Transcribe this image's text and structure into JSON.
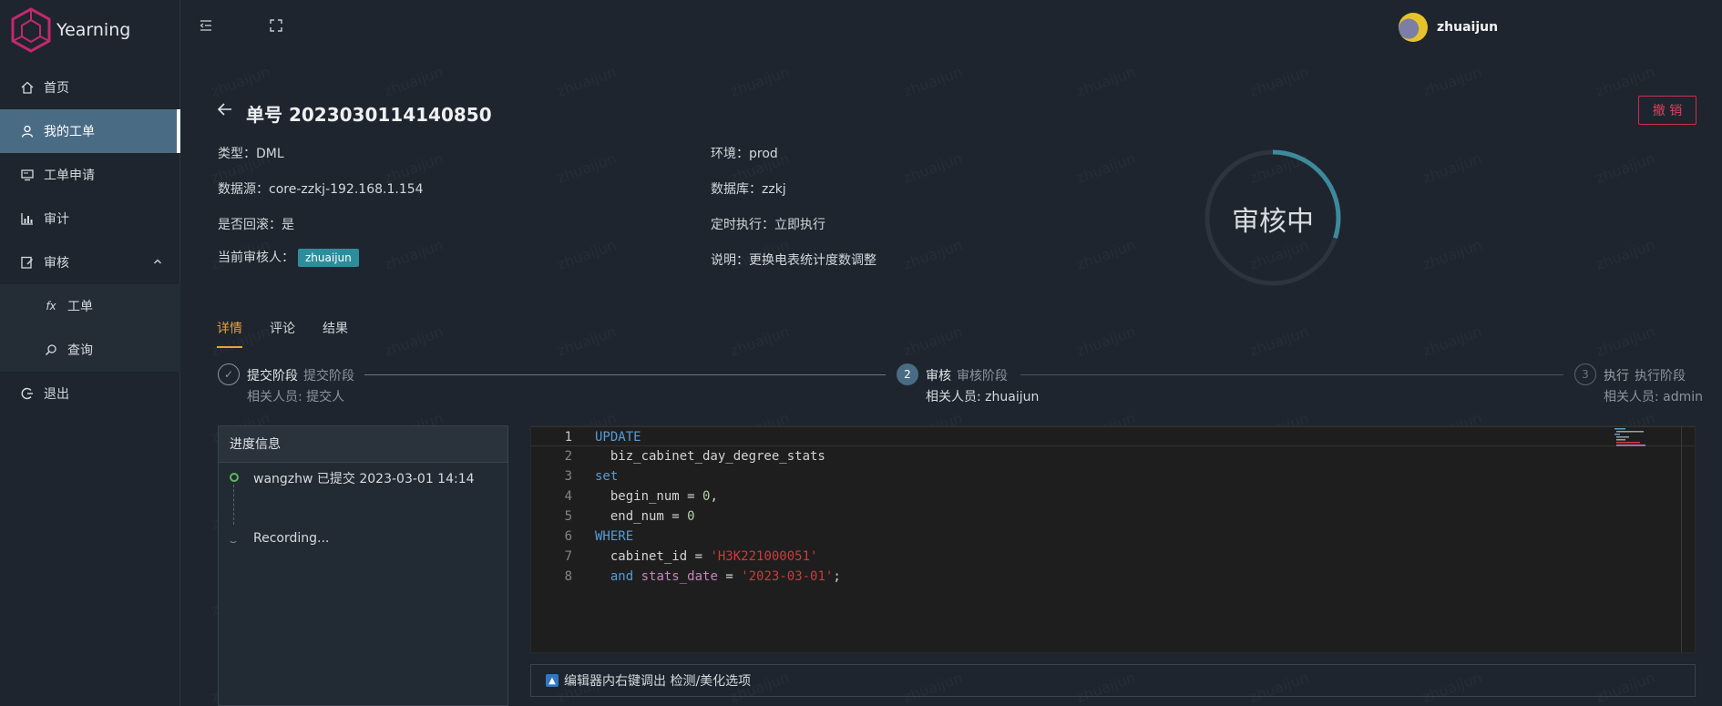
{
  "app": {
    "name": "Yearning",
    "watermark": "zhuaijun"
  },
  "sidebar": {
    "items": [
      {
        "label": "首页",
        "icon": "home-icon"
      },
      {
        "label": "我的工单",
        "icon": "user-icon"
      },
      {
        "label": "工单申请",
        "icon": "monitor-icon"
      },
      {
        "label": "审计",
        "icon": "chart-icon"
      },
      {
        "label": "审核",
        "icon": "edit-icon"
      },
      {
        "label": "工单",
        "icon": "fx-icon"
      },
      {
        "label": "查询",
        "icon": "search-icon"
      },
      {
        "label": "退出",
        "icon": "logout-icon"
      }
    ]
  },
  "header": {
    "username": "zhuaijun"
  },
  "order": {
    "title": "单号 2023030114140850",
    "revoke_label": "撤 销",
    "type": "类型：DML",
    "source": "数据源：core-zzkj-192.168.1.154",
    "rollback": "是否回滚：是",
    "reviewer_label": "当前审核人：",
    "reviewer": "zhuaijun",
    "env": "环境：prod",
    "database": "数据库：zzkj",
    "schedule": "定时执行：立即执行",
    "note": "说明：更换电表统计度数调整",
    "status": "审核中",
    "status_progress": 0.3
  },
  "tabs": [
    "详情",
    "评论",
    "结果"
  ],
  "steps": [
    {
      "title": "提交阶段",
      "desc": "提交阶段",
      "sub": "相关人员: 提交人",
      "marker": "✓"
    },
    {
      "title": "审核",
      "desc": "审核阶段",
      "sub": "相关人员: zhuaijun",
      "marker": "2"
    },
    {
      "title": "执行",
      "desc": "执行阶段",
      "sub": "相关人员: admin",
      "marker": "3"
    }
  ],
  "progress": {
    "header": "进度信息",
    "entries": [
      "wangzhw 已提交 2023-03-01 14:14",
      "Recording..."
    ]
  },
  "editor": {
    "line_numbers": [
      "1",
      "2",
      "3",
      "4",
      "5",
      "6",
      "7",
      "8"
    ],
    "hint": "编辑器内右键调出 检测/美化选项"
  },
  "colors": {
    "accent": "#4a6b84",
    "tab_active": "#e8a13a",
    "ring": "#3d8a9c",
    "revoke": "#c9304f",
    "badge": "#2e8d9c"
  }
}
